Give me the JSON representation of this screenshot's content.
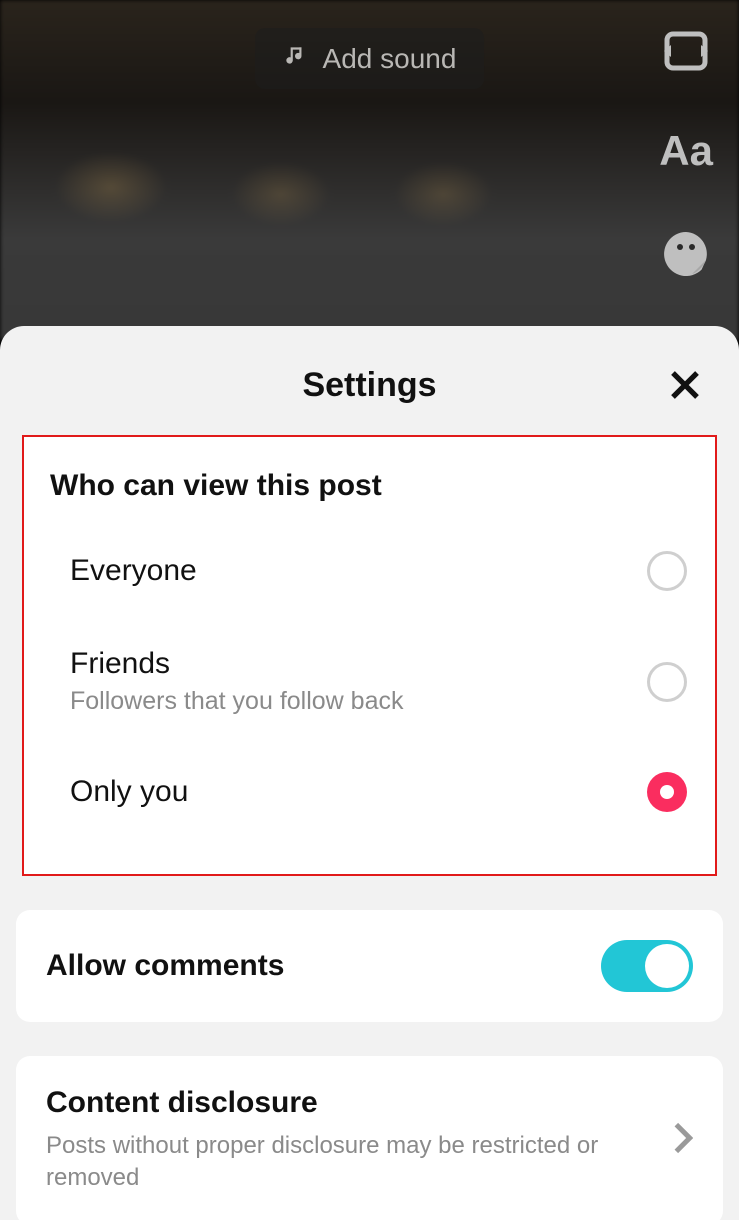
{
  "editor": {
    "add_sound_label": "Add sound"
  },
  "sheet": {
    "title": "Settings",
    "privacy": {
      "section_title": "Who can view this post",
      "options": [
        {
          "label": "Everyone",
          "sublabel": "",
          "selected": false
        },
        {
          "label": "Friends",
          "sublabel": "Followers that you follow back",
          "selected": false
        },
        {
          "label": "Only you",
          "sublabel": "",
          "selected": true
        }
      ]
    },
    "allow_comments": {
      "label": "Allow comments",
      "enabled": true
    },
    "content_disclosure": {
      "label": "Content disclosure",
      "sublabel": "Posts without proper disclosure may be restricted or removed"
    }
  }
}
